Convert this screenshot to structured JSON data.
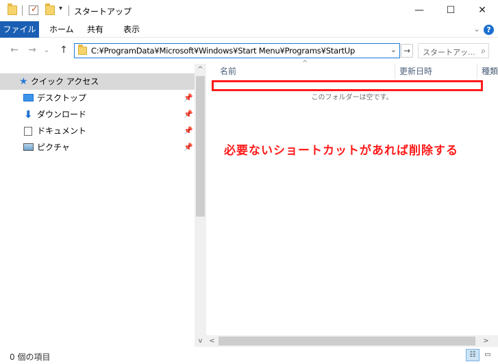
{
  "window": {
    "title": "スタートアップ",
    "minimize_glyph": "—",
    "maximize_glyph": "☐",
    "close_glyph": "✕"
  },
  "quick_access_toolbar": {
    "dropdown_glyph": "▾"
  },
  "ribbon": {
    "tabs": [
      {
        "label": "ファイル"
      },
      {
        "label": "ホーム"
      },
      {
        "label": "共有"
      },
      {
        "label": "表示"
      }
    ],
    "expand_glyph": "⌄",
    "help_glyph": "?"
  },
  "navigation": {
    "back_glyph": "←",
    "forward_glyph": "→",
    "recent_glyph": "⌄",
    "up_glyph": "↑",
    "address": "C:¥ProgramData¥Microsoft¥Windows¥Start Menu¥Programs¥StartUp",
    "address_dropdown_glyph": "⌄",
    "go_glyph": "→",
    "search_placeholder": "スタートアッ...",
    "search_glyph": "⌕"
  },
  "nav_pane": {
    "items": [
      {
        "label": "クイック アクセス",
        "icon": "star-icon"
      },
      {
        "label": "デスクトップ",
        "icon": "desktop-icon",
        "pinned": true
      },
      {
        "label": "ダウンロード",
        "icon": "download-arrow-icon",
        "pinned": true
      },
      {
        "label": "ドキュメント",
        "icon": "document-icon",
        "pinned": true
      },
      {
        "label": "ピクチャ",
        "icon": "pictures-icon",
        "pinned": true
      }
    ],
    "pin_glyph": "📌"
  },
  "content": {
    "columns": [
      {
        "label": "名前"
      },
      {
        "label": "更新日時"
      },
      {
        "label": "種類"
      }
    ],
    "sort_glyph": "^",
    "empty_message": "このフォルダーは空です。",
    "annotation": "必要ないショートカットがあれば削除する"
  },
  "scrollbars": {
    "up_glyph": "^",
    "down_glyph": "v",
    "left_glyph": "<",
    "right_glyph": ">"
  },
  "status_bar": {
    "item_count": "0 個の項目"
  },
  "colors": {
    "accent": "#1a5fb4",
    "annotation": "#ff1a1a"
  }
}
